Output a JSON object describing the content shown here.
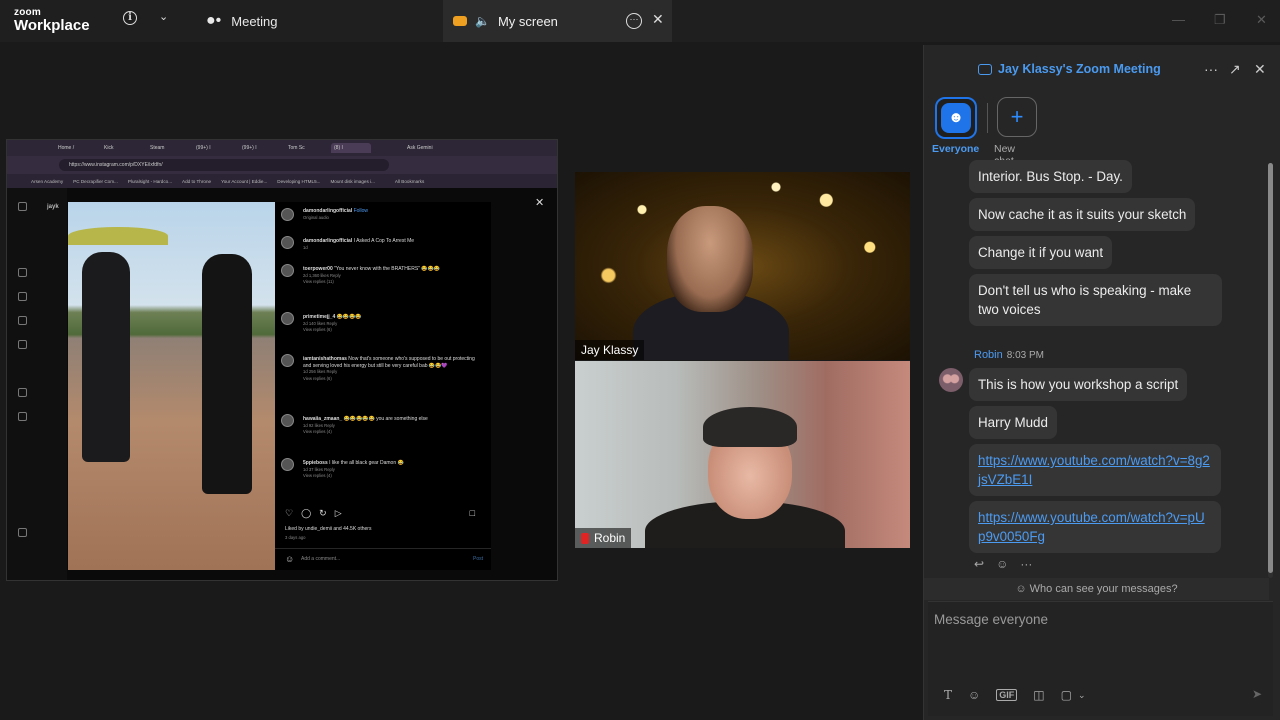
{
  "topbar": {
    "logo_top": "zoom",
    "logo_bottom": "Workplace",
    "meeting_tab": "Meeting",
    "screen_tab": "My screen"
  },
  "shared_screen": {
    "browser_tabs": [
      "Home /",
      "Kick",
      "Steam",
      "(99+) I",
      "(99+) I",
      "Tom Sc",
      "(8) I"
    ],
    "ask_gemini": "Ask Gemini",
    "url": "https://www.instagram.com/p/DXYE/ixfdfn/",
    "bookmarks": [
      "Arsen Academy",
      "PC Decrapifier Com...",
      "Pluralsight - Hardco...",
      "Add to Throne",
      "Your Account | Eddie...",
      "Developing HTML5...",
      "Mount disk images i...",
      "All Bookmarks"
    ],
    "username": "jayk",
    "post_author": "damondarlingofficial",
    "follow": "Follow",
    "audio": "Original audio",
    "comments": [
      {
        "user": "damondarlingofficial",
        "text": "I Asked A Cop To Arrest Me",
        "meta": "1d"
      },
      {
        "user": "toerpower00",
        "text": "\"You never know with the BRATHERS\" 😂😂😂",
        "meta": "2d  1,360 likes  Reply",
        "replies": "View replies (11)"
      },
      {
        "user": "primetimejj_4",
        "text": "😂😂😂😂",
        "meta": "2d  140 likes  Reply",
        "replies": "View replies (6)"
      },
      {
        "user": "iamtanishathomas",
        "text": "Now that's someone who's supposed to be out protecting and serving loved his energy but still be very careful bab 😂😂💜",
        "meta": "1d  256 likes  Reply",
        "replies": "View replies (6)"
      },
      {
        "user": "hawaiia_zmaan_",
        "text": "😂😂😂😂😂 you are something else",
        "meta": "1d  92 likes  Reply",
        "replies": "View replies (4)"
      },
      {
        "user": "5ppieboss",
        "text": "I like the all black gear Damon 😂",
        "meta": "1d  37 likes  Reply",
        "replies": "View replies (4)"
      }
    ],
    "liked_by": "Liked by undie_demii and 44.5K others",
    "posted": "3 days ago",
    "add_comment": "Add a comment...",
    "post_btn": "Post"
  },
  "videos": {
    "tile1_name": "Jay Klassy",
    "tile2_name": "Robin"
  },
  "chat": {
    "title": "Jay Klassy's Zoom Meeting",
    "tab_everyone": "Everyone",
    "tab_new": "New chat",
    "messages": [
      "Interior. Bus Stop. - Day.",
      "Now cache it as it suits your sketch",
      "Change it if you want",
      "Don't tell us who is speaking - make two voices"
    ],
    "sender_name": "Robin",
    "sender_time": "8:03 PM",
    "robin_messages": [
      "This is how you workshop a script",
      "Harry Mudd"
    ],
    "link1": "https://www.youtube.com/watch?v=8g2jsVZbE1I",
    "link2": "https://www.youtube.com/watch?v=pUp9v0050Fg",
    "who_can_see": "Who can see your messages?",
    "input_placeholder": "Message everyone",
    "gif_label": "GIF"
  },
  "colors": {
    "accent": "#1e74e8",
    "link": "#4c9bf2",
    "panel": "#262626"
  }
}
